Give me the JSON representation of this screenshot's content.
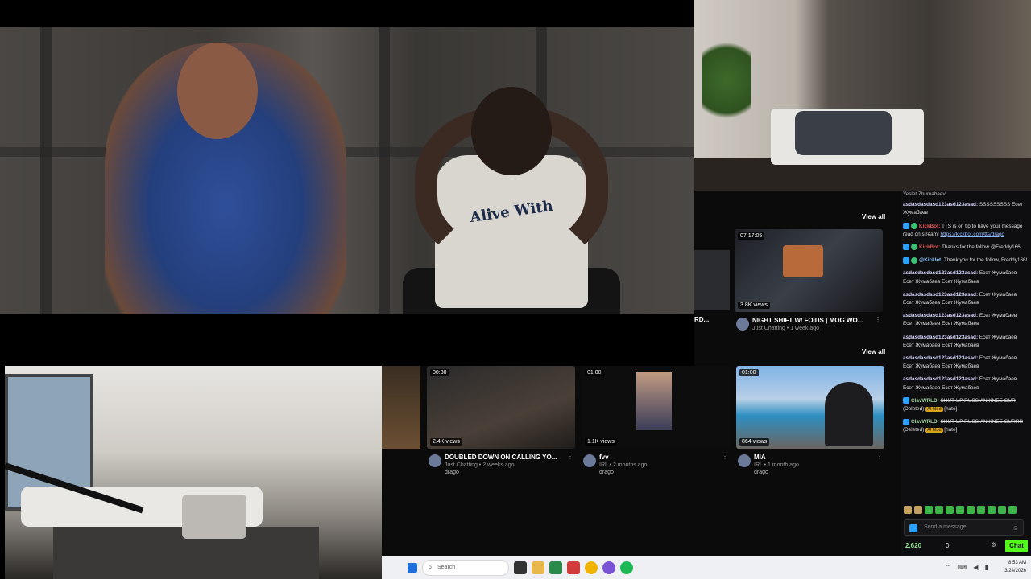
{
  "scenes": {
    "main_shirt_text": "Alive With",
    "bedroom": "",
    "living": ""
  },
  "browser": {
    "view_all_1": "View all",
    "view_all_2": "View all",
    "partial_title": "RD...",
    "top_card": {
      "duration": "07:17:05",
      "views": "3.8K views",
      "title": "NIGHT SHIFT W/ FOIDS | MOG WO...",
      "sub": "Just Chatting • 1 week ago"
    },
    "cards": [
      {
        "duration": "00:30",
        "views": "2.4K views",
        "title": "DOUBLED DOWN ON CALLING YO...",
        "sub": "Just Chatting • 2 weeks ago",
        "channel": "drago"
      },
      {
        "duration": "01:00",
        "views": "1.1K views",
        "title": "fvv",
        "sub": "IRL • 2 months ago",
        "channel": "drago"
      },
      {
        "duration": "01:00",
        "views": "864 views",
        "title": "MIA",
        "sub": "IRL • 1 month ago",
        "channel": "drago"
      }
    ]
  },
  "chat": {
    "top_user": "Yeslet Zhumabaev",
    "messages": [
      {
        "user": "asdasdasdasd123asd123asad:",
        "text": "SSSSSSSSS Есет Жумабаев"
      },
      {
        "user": "KickBot:",
        "text": "TTS is on tip to have your message read on stream!",
        "link": "https://kickbot.com/tts/drago"
      },
      {
        "user": "KickBot:",
        "text": "Thanks for the follow @Freddy166!"
      },
      {
        "user": "@Kicklet:",
        "text": "Thank you for the follow, Freddy166!"
      },
      {
        "user": "asdasdasdasd123asd123asad:",
        "text": "Есет Жумабаев Есет Жумабаев Есет Жумабаев"
      },
      {
        "user": "asdasdasdasd123asd123asad:",
        "text": "Есет Жумабаев Есет Жумабаев Есет Жумабаев"
      },
      {
        "user": "asdasdasdasd123asd123asad:",
        "text": "Есет Жумабаев Есет Жумабаев Есет Жумабаев"
      },
      {
        "user": "asdasdasdasd123asd123asad:",
        "text": "Есет Жумабаев Есет Жумабаев Есет Жумабаев"
      },
      {
        "user": "asdasdasdasd123asd123asad:",
        "text": "Есет Жумабаев Есет Жумабаев Есет Жумабаев"
      },
      {
        "user": "asdasdasdasd123asd123asad:",
        "text": "Есет Жумабаев Есет Жумабаев Есет Жумабаев"
      },
      {
        "user": "ClavWRLD:",
        "text": "SHUT UP RUSSIAN KNEE GUR",
        "deleted": "(Deleted)",
        "tag": "AI Mod",
        "reason": "[hate]"
      },
      {
        "user": "ClavWRLD:",
        "text": "SHUT UP RUSSIAN KNEE GURRR",
        "deleted": "(Deleted)",
        "tag": "AI Mod",
        "reason": "[hate]"
      }
    ],
    "input_placeholder": "Send a message",
    "points": "2,620",
    "zero": "0",
    "chat_button": "Chat"
  },
  "taskbar": {
    "search": "Search",
    "time": "8:53 AM",
    "date": "3/24/2026"
  }
}
